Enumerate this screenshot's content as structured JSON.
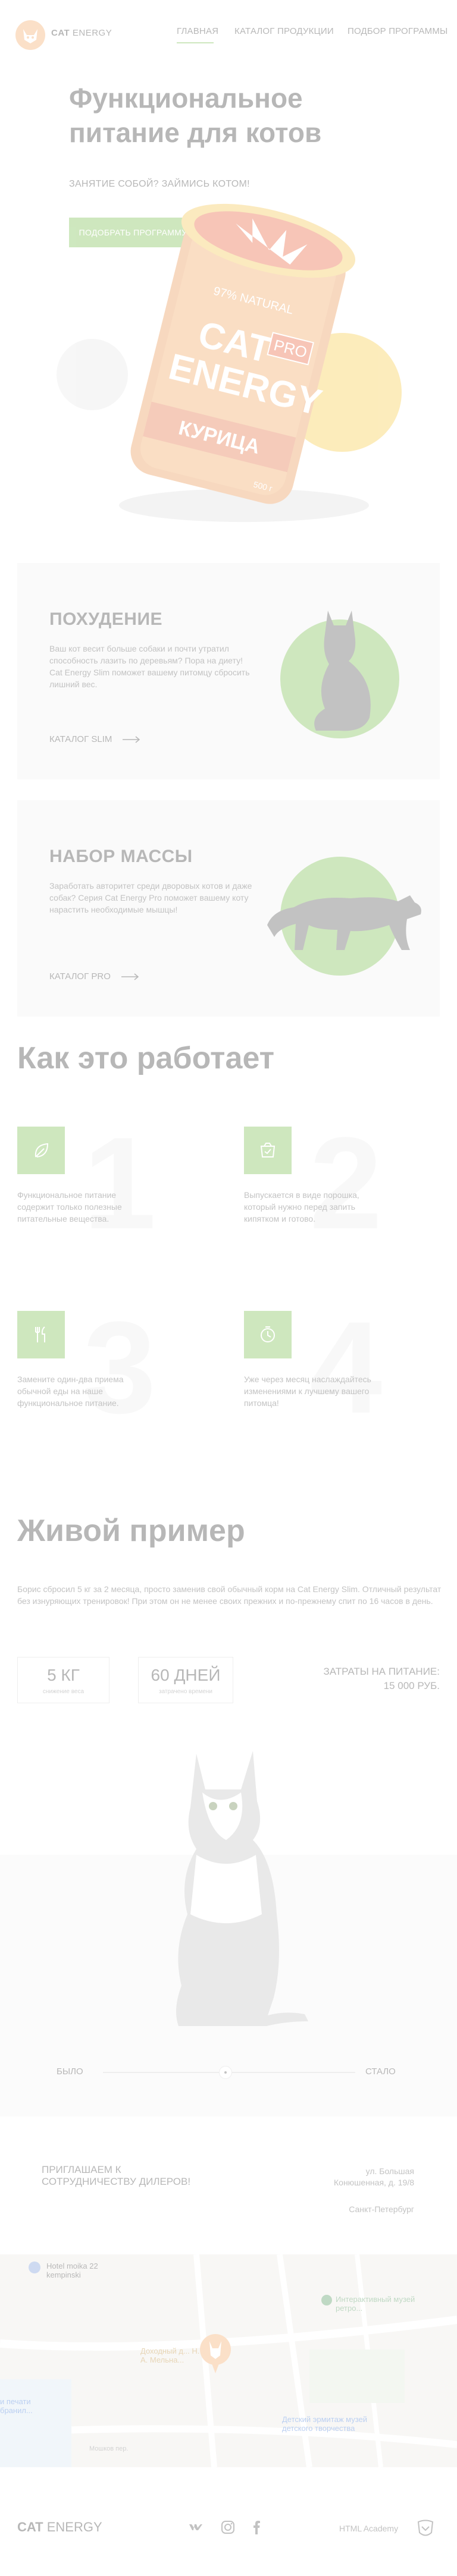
{
  "header": {
    "logo_word1": "CAT",
    "logo_word2": " ENERGY",
    "nav": [
      "ГЛАВНАЯ",
      "КАТАЛОГ ПРОДУКЦИИ",
      "ПОДБОР ПРОГРАММЫ"
    ]
  },
  "hero": {
    "title": "Функциональное питание для котов",
    "subtitle": "ЗАНЯТИЕ СОБОЙ? ЗАЙМИСЬ КОТОМ!",
    "button": "ПОДОБРАТЬ ПРОГРАММУ",
    "package": {
      "brand1": "CAT",
      "brand2": "ENERGY",
      "pro": "PRO",
      "flavor": "КУРИЦА",
      "natural": "97% NATURAL",
      "weight": "500 г"
    }
  },
  "cards": [
    {
      "title": "ПОХУДЕНИЕ",
      "text": "Ваш кот весит больше собаки и почти утратил способность лазить по деревьям? Пора на диету! Cat Energy Slim поможет вашему питомцу сбросить лишний вес.",
      "link": "КАТАЛОГ SLIM"
    },
    {
      "title": "НАБОР МАССЫ",
      "text": "Заработать авторитет среди дворовых котов и даже собак? Серия Cat Energy Pro поможет вашему коту нарастить необходимые мышцы!",
      "link": "КАТАЛОГ PRO"
    }
  ],
  "how": {
    "title": "Как это работает",
    "steps": [
      {
        "num": "1",
        "icon": "leaf-icon",
        "text": "Функциональное питание содержит только полезные питательные вещества."
      },
      {
        "num": "2",
        "icon": "package-icon",
        "text": "Выпускается в виде порошка, который нужно перед запить кипятком и готово."
      },
      {
        "num": "3",
        "icon": "cutlery-icon",
        "text": "Замените один-два приема обычной еды на наше функциональное питание."
      },
      {
        "num": "4",
        "icon": "clock-icon",
        "text": "Уже через месяц наслаждайтесь изменениями к лучшему вашего питомца!"
      }
    ]
  },
  "live": {
    "title": "Живой пример",
    "text": "Борис сбросил 5 кг за 2 месяца, просто заменив свой обычный корм на Cat Energy Slim. Отличный результат без изнуряющих тренировок! При этом он не менее своих прежних и по-прежнему спит по 16 часов в день.",
    "stats": [
      {
        "value": "5 КГ",
        "label": "снижение веса"
      },
      {
        "value": "60 ДНЕЙ",
        "label": "затрачено времени"
      }
    ],
    "cost_label": "ЗАТРАТЫ НА ПИТАНИЕ:",
    "cost_value": "15 000 РУБ.",
    "before": "БЫЛО",
    "after": "СТАЛО"
  },
  "contacts": {
    "dealers": "ПРИГЛАШАЕМ К СОТРУДНИЧЕСТВУ ДИЛЕРОВ!",
    "address1": "ул. Большая",
    "address2": "Конюшенная, д. 19/8",
    "city": "Санкт-Петербург",
    "map_labels": {
      "hotel": "Hotel moika 22 kempinski",
      "museum": "Интерактивный музей ретро...",
      "house": "Доходный д... Н. А. Мельна...",
      "print": "и печати бранил...",
      "ermitage": "Детский эрмитаж музей детского творчества",
      "street": "Мошков пер."
    }
  },
  "footer": {
    "logo1": "CAT",
    "logo2": " ENERGY",
    "socials": [
      "vk-icon",
      "instagram-icon",
      "facebook-icon"
    ],
    "academy": "HTML Academy"
  },
  "colors": {
    "accent": "#68b738",
    "yellow": "#f7c52e",
    "orange": "#f3a057",
    "card": "#f0f0f0"
  }
}
